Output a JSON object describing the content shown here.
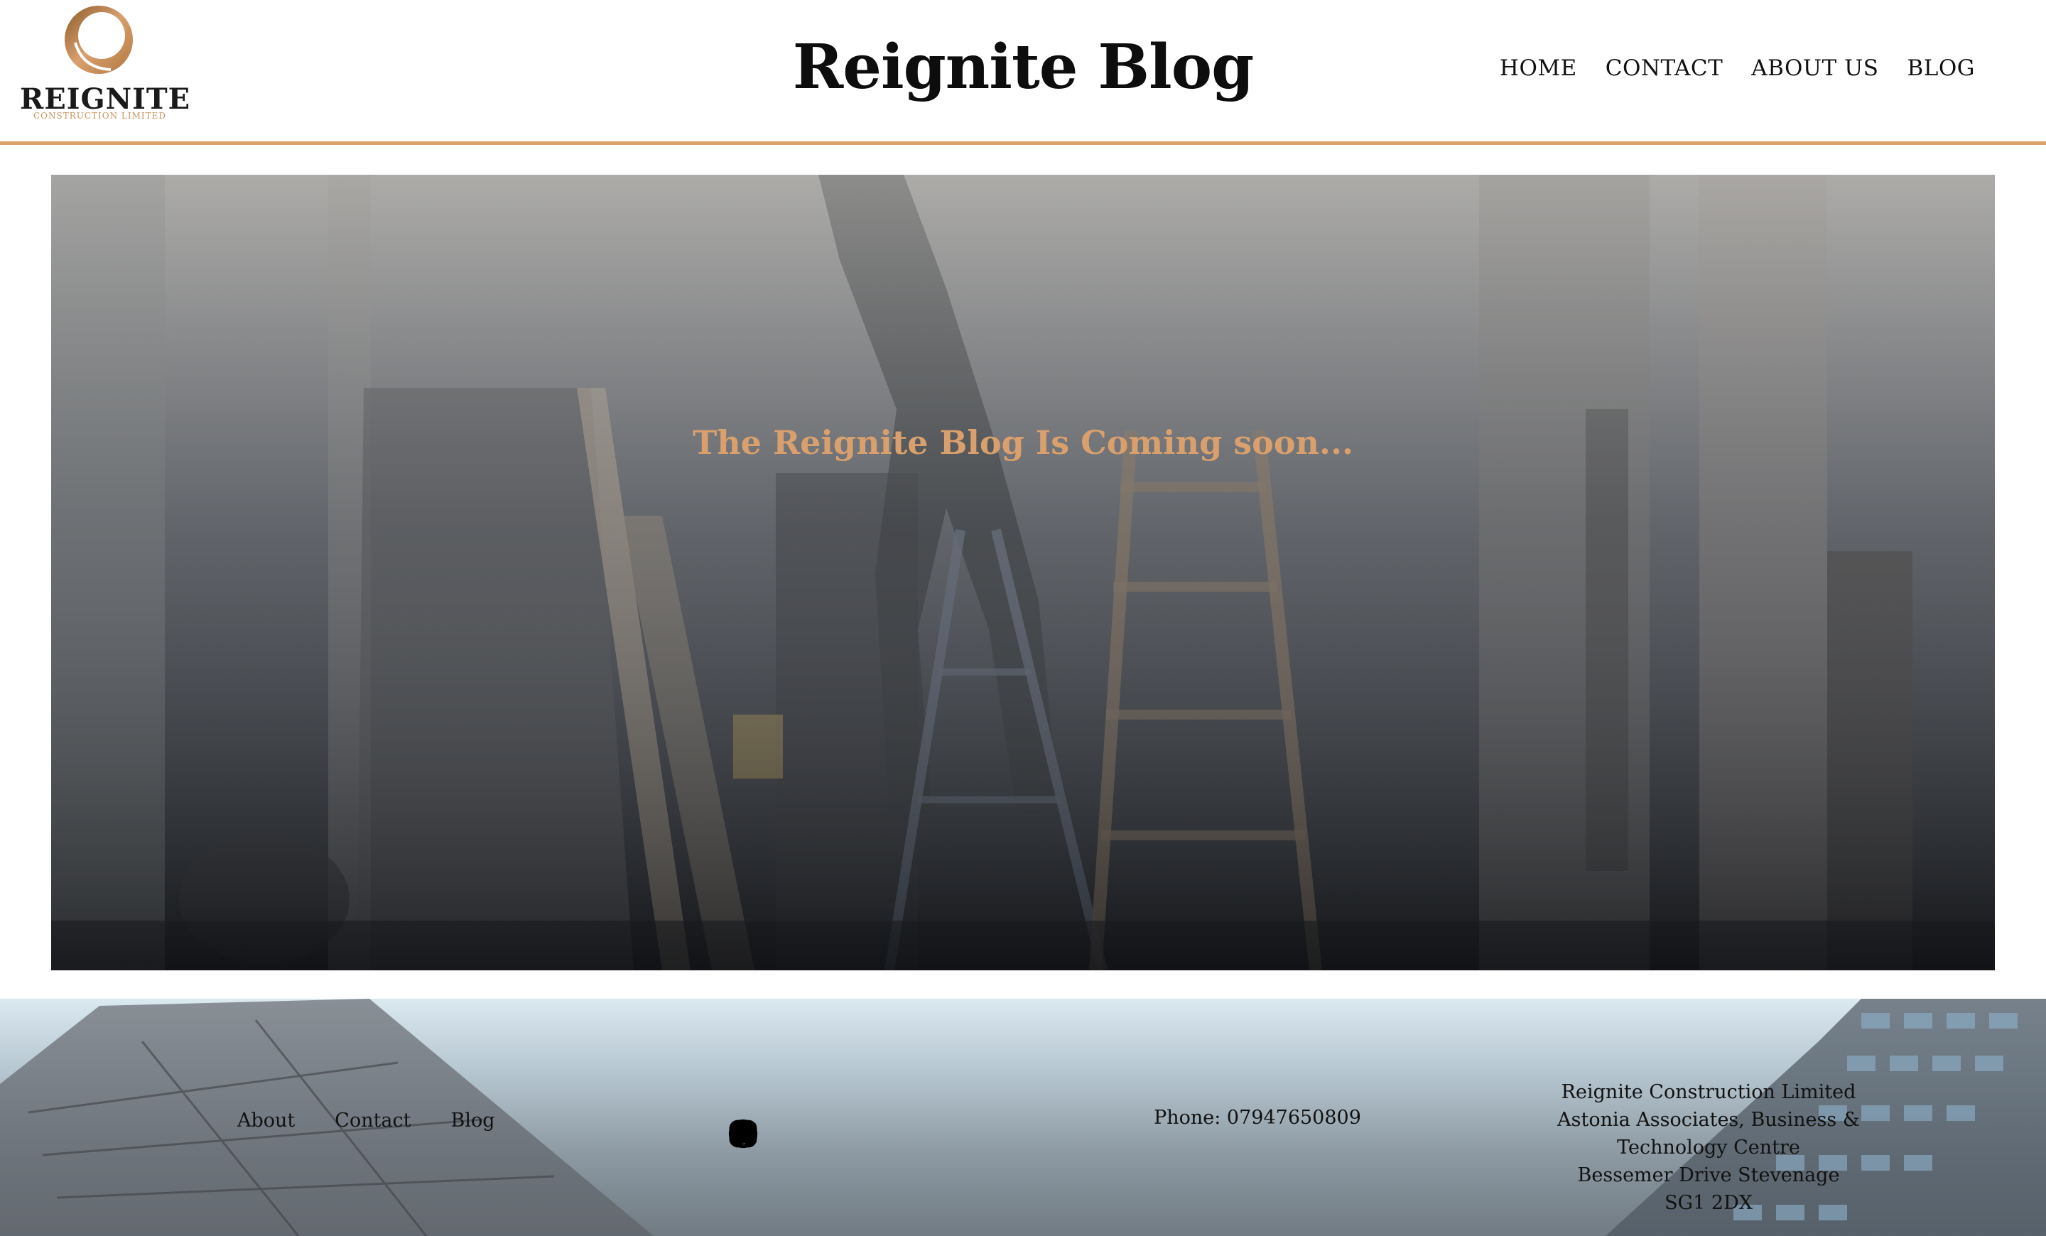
{
  "header": {
    "logo": {
      "wordmark": "REIGNITE",
      "subtitle": "CONSTRUCTION LIMITED"
    },
    "title": "Reignite Blog",
    "nav": [
      {
        "label": "HOME"
      },
      {
        "label": "CONTACT"
      },
      {
        "label": "ABOUT US"
      },
      {
        "label": "BLOG"
      }
    ]
  },
  "hero": {
    "caption": "The Reignite Blog Is Coming soon..."
  },
  "footer": {
    "links": [
      {
        "label": "About"
      },
      {
        "label": "Contact"
      },
      {
        "label": "Blog"
      }
    ],
    "social": [
      {
        "icon": "facebook-icon"
      },
      {
        "icon": "instagram-icon"
      },
      {
        "icon": "twitter-icon"
      }
    ],
    "phone": "Phone: 07947650809",
    "address": {
      "line1": "Reignite Construction Limited",
      "line2": "Astonia Associates, Business &",
      "line3": "Technology Centre",
      "line4": "Bessemer Drive Stevenage",
      "line5": "SG1 2DX"
    }
  },
  "colors": {
    "accent": "#d9a06d",
    "text": "#111111",
    "background": "#ffffff"
  }
}
